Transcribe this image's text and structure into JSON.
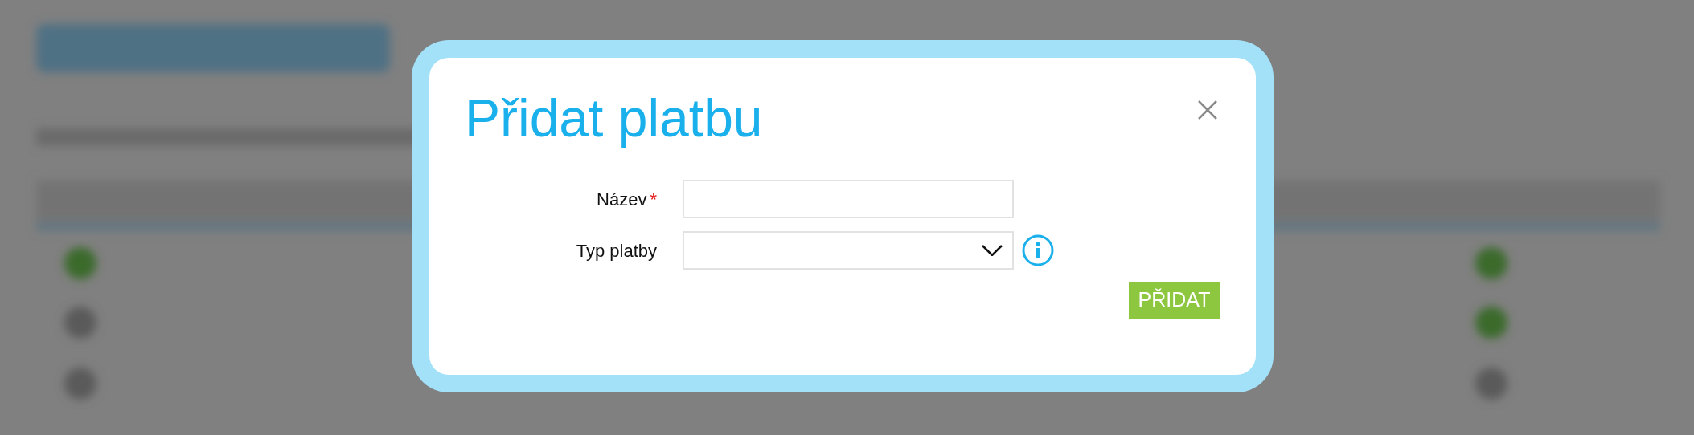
{
  "dialog": {
    "title": "Přidat platbu",
    "fields": [
      {
        "kind": "text",
        "label": "Název",
        "required": true,
        "required_mark": "*",
        "info": false
      },
      {
        "kind": "select",
        "label": "Typ platby",
        "required": false,
        "info": true
      }
    ],
    "submit": "PŘIDAT"
  }
}
